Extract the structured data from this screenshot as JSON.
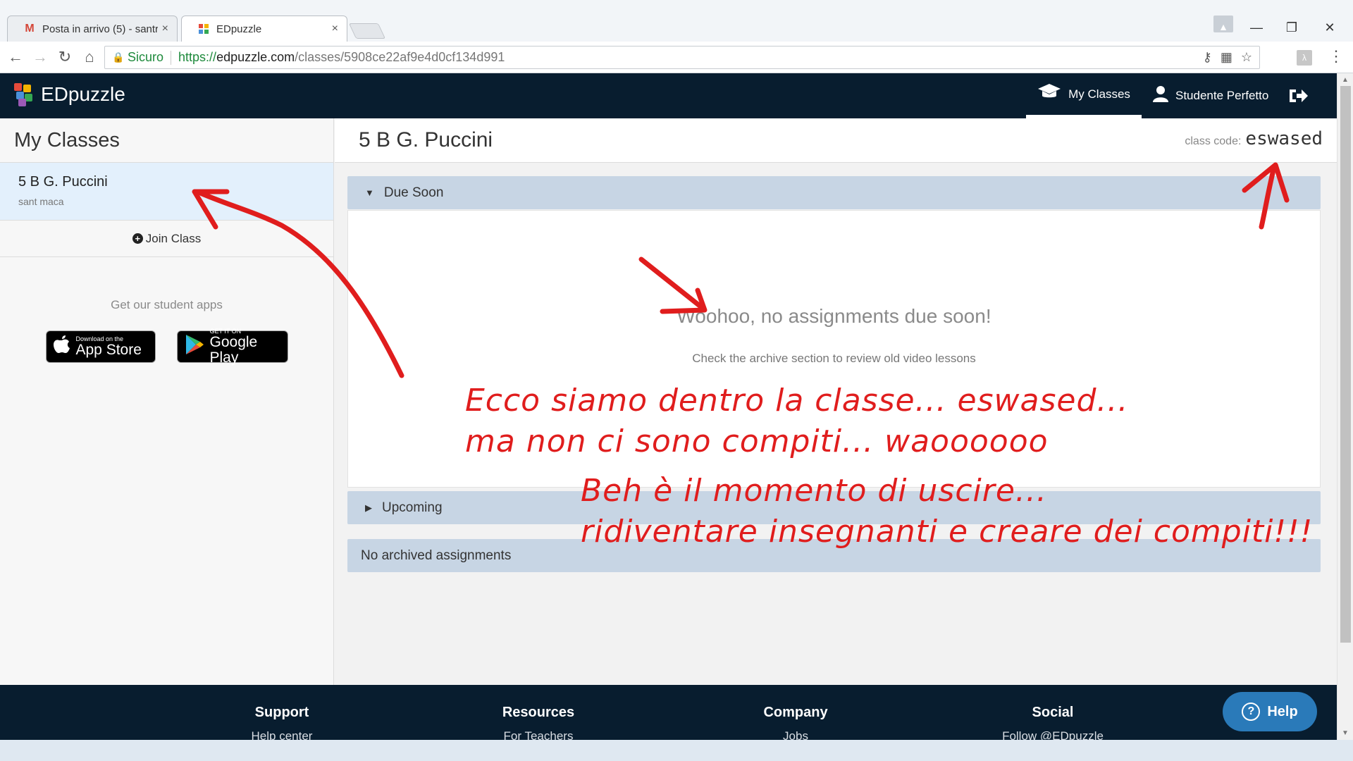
{
  "browser": {
    "tabs": [
      {
        "title": "Posta in arrivo (5) - santr",
        "favicon": "gmail-icon",
        "active": false
      },
      {
        "title": "EDpuzzle",
        "favicon": "edpuzzle-icon",
        "active": true
      }
    ],
    "close_glyph": "×",
    "secure_label": "Sicuro",
    "url_scheme": "https://",
    "url_host": "edpuzzle.com",
    "url_path": "/classes/5908ce22af9e4d0cf134d991"
  },
  "header": {
    "logo_text": "EDpuzzle",
    "nav": [
      {
        "label": "My Classes",
        "icon": "graduation-cap-icon",
        "active": true
      },
      {
        "label": "Studente Perfetto",
        "icon": "user-icon",
        "active": false
      }
    ],
    "logout_icon": "logout-icon"
  },
  "sidebar": {
    "title": "My Classes",
    "classes": [
      {
        "name": "5 B G. Puccini",
        "teacher": "sant maca"
      }
    ],
    "join_label": "Join Class",
    "apps_label": "Get our student apps",
    "app_store": {
      "small": "Download on the",
      "big": "App Store"
    },
    "google_play": {
      "small": "GET IT ON",
      "big": "Google Play"
    }
  },
  "main": {
    "title": "5 B G. Puccini",
    "class_code_label": "class code:",
    "class_code": "eswased",
    "due_soon_label": "Due Soon",
    "empty_title": "Woohoo, no assignments due soon!",
    "empty_subtitle": "Check the archive section to review old video lessons",
    "upcoming_label": "Upcoming",
    "archived_label": "No archived assignments"
  },
  "footer": {
    "columns": [
      {
        "heading": "Support",
        "link": "Help center"
      },
      {
        "heading": "Resources",
        "link": "For Teachers"
      },
      {
        "heading": "Company",
        "link": "Jobs"
      },
      {
        "heading": "Social",
        "link": "Follow @EDpuzzle"
      }
    ],
    "help_label": "Help"
  },
  "annotations": {
    "lines": [
      "Ecco siamo dentro la classe... eswased...",
      "ma non ci sono compiti... waoooooo",
      "Beh è il momento di uscire...",
      "ridiventare insegnanti e creare dei compiti!!!"
    ],
    "color": "#e01d1d"
  },
  "colors": {
    "header_bg": "#081d2f",
    "selected_class_bg": "#e3f0fc",
    "panel_head_bg": "#c7d5e4",
    "help_button": "#2a7ab9"
  }
}
